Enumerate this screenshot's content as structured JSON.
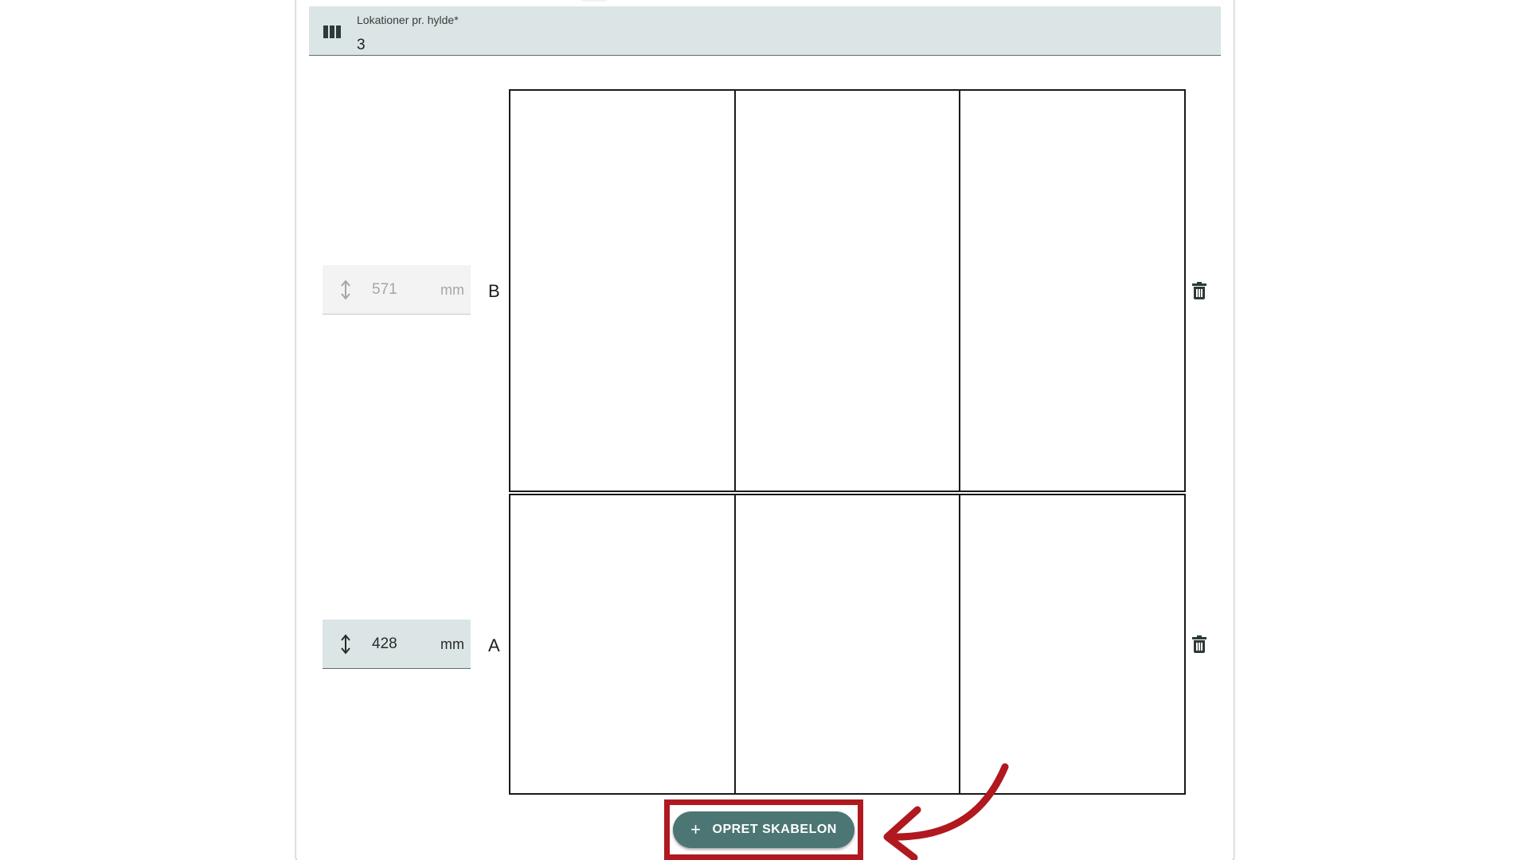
{
  "locations_field": {
    "label": "Lokationer pr. hylde*",
    "value": "3",
    "icon": "columns-icon"
  },
  "shelves": [
    {
      "letter": "B",
      "height_value": "571",
      "height_unit": "mm",
      "cells": 3,
      "height_icon": "vertical-resize-icon",
      "delete_icon": "trash-icon"
    },
    {
      "letter": "A",
      "height_value": "428",
      "height_unit": "mm",
      "cells": 3,
      "height_icon": "vertical-resize-icon",
      "delete_icon": "trash-icon"
    }
  ],
  "create_button": {
    "icon": "plus-icon",
    "label": "OPRET SKABELON"
  },
  "colors": {
    "accent": "#4b7673",
    "field_fill": "#dbe5e5",
    "annotation": "#b0191f"
  }
}
